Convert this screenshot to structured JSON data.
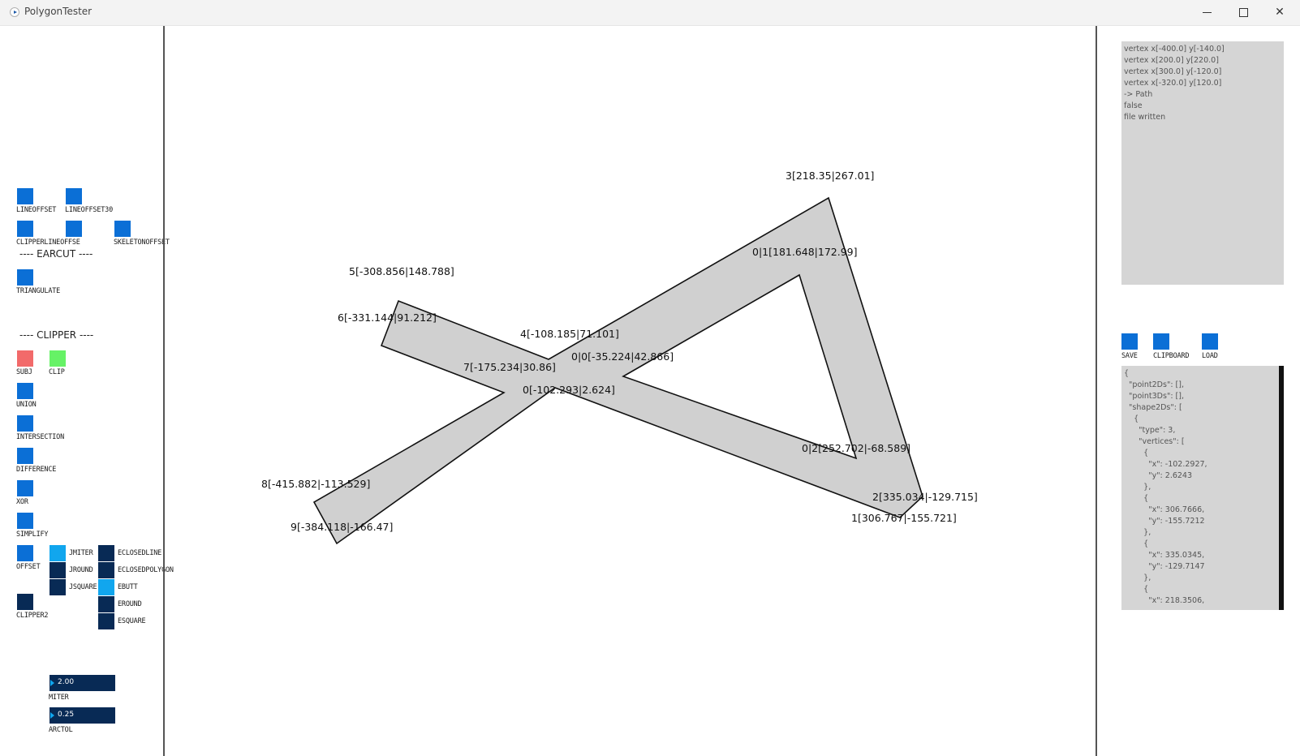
{
  "window": {
    "title": "PolygonTester"
  },
  "left": {
    "line_offset": "LINEOFFSET",
    "line_offset30": "LINEOFFSET30",
    "clipper_line_offset": "CLIPPERLINEOFFSE",
    "skeleton_offset": "SKELETONOFFSET",
    "earcut_header": "---- EARCUT ----",
    "triangulate": "TRIANGULATE",
    "clipper_header": "---- CLIPPER ----",
    "subj": "SUBJ",
    "clip": "CLIP",
    "union": "UNION",
    "intersection": "INTERSECTION",
    "difference": "DIFFERENCE",
    "xor": "XOR",
    "simplify": "SIMPLIFY",
    "offset": "OFFSET",
    "clipper2": "CLIPPER2",
    "jmiter": "JMITER",
    "jround": "JROUND",
    "jsquare": "JSQUARE",
    "eclosedline": "ECLOSEDLINE",
    "eclosedpolygon": "ECLOSEDPOLYGON",
    "ebutt": "EBUTT",
    "eround": "EROUND",
    "esquare": "ESQUARE",
    "miter": {
      "label": "MITER",
      "value": "2.00"
    },
    "arctol": {
      "label": "ARCTOL",
      "value": "0.25"
    }
  },
  "colors": {
    "button": "#0b6fd6",
    "button_off": "#082a55",
    "button_on": "#11a6ee",
    "subj": "#f26a6a",
    "clip": "#66f266",
    "polygon_fill": "#d0d0d0"
  },
  "canvas": {
    "labels": [
      "3[218.35|267.01]",
      "0|1[181.648|172.99]",
      "5[-308.856|148.788]",
      "6[-331.144|91.212]",
      "4[-108.185|71.101]",
      "0|0[-35.224|42.866]",
      "7[-175.234|30.86]",
      "0[-102.293|2.624]",
      "0|2[252.702|-68.589]",
      "8[-415.882|-113.529]",
      "2[335.034|-129.715]",
      "1[306.767|-155.721]",
      "9[-384.118|-166.47]"
    ]
  },
  "right": {
    "log": [
      "vertex x[-400.0] y[-140.0]",
      "vertex x[200.0] y[220.0]",
      "vertex x[300.0] y[-120.0]",
      "vertex x[-320.0] y[120.0]",
      "-> Path",
      "false",
      "file written"
    ],
    "save": "SAVE",
    "clipboard": "CLIPBOARD",
    "load": "LOAD",
    "json": "{\n  \"point2Ds\": [],\n  \"point3Ds\": [],\n  \"shape2Ds\": [\n    {\n      \"type\": 3,\n      \"vertices\": [\n        {\n          \"x\": -102.2927,\n          \"y\": 2.6243\n        },\n        {\n          \"x\": 306.7666,\n          \"y\": -155.7212\n        },\n        {\n          \"x\": 335.0345,\n          \"y\": -129.7147\n        },\n        {\n          \"x\": 218.3506,"
  }
}
